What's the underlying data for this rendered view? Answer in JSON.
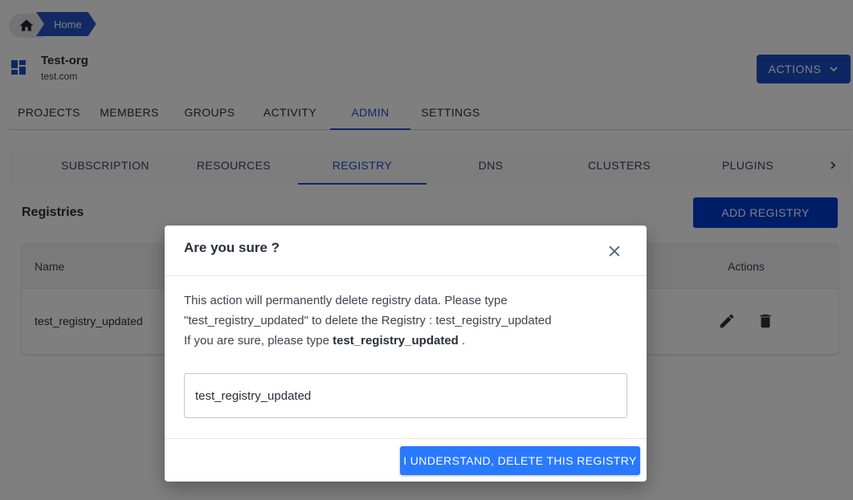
{
  "breadcrumb": {
    "home_icon": "home-icon",
    "items": [
      {
        "label": "Home"
      }
    ]
  },
  "org": {
    "icon": "dashboard-icon",
    "name": "Test-org",
    "domain": "test.com"
  },
  "header": {
    "actions_label": "ACTIONS",
    "actions_icon": "chevron-down-icon"
  },
  "main_tabs": [
    {
      "label": "PROJECTS",
      "active": false
    },
    {
      "label": "MEMBERS",
      "active": false
    },
    {
      "label": "GROUPS",
      "active": false
    },
    {
      "label": "ACTIVITY",
      "active": false
    },
    {
      "label": "ADMIN",
      "active": true
    },
    {
      "label": "SETTINGS",
      "active": false
    }
  ],
  "sub_tabs": [
    {
      "label": "SUBSCRIPTION",
      "active": false
    },
    {
      "label": "RESOURCES",
      "active": false
    },
    {
      "label": "REGISTRY",
      "active": true
    },
    {
      "label": "DNS",
      "active": false
    },
    {
      "label": "CLUSTERS",
      "active": false
    },
    {
      "label": "PLUGINS",
      "active": false
    }
  ],
  "sub_tabs_next_icon": "chevron-right-icon",
  "section": {
    "title": "Registries",
    "add_button": "ADD REGISTRY"
  },
  "table": {
    "columns": [
      "Name",
      "Actions"
    ],
    "rows": [
      {
        "name": "test_registry_updated",
        "actions": [
          "edit-icon",
          "delete-icon"
        ]
      }
    ]
  },
  "modal": {
    "title": "Are you sure ?",
    "close_icon": "close-icon",
    "message_line1": "This action will permanently delete registry data. Please type",
    "message_line2": "\"test_registry_updated\" to delete the Registry : test_registry_updated",
    "message_line3_prefix": "If you are sure, please type ",
    "message_line3_bold": "test_registry_updated",
    "message_line3_suffix": " .",
    "input_value": "test_registry_updated",
    "confirm_button": "I UNDERSTAND, DELETE THIS REGISTRY"
  },
  "colors": {
    "primary": "#1a4fc7",
    "add_button": "#003bd1",
    "delete_button": "#2979ff",
    "overlay": "rgba(0,0,0,0.5)"
  }
}
